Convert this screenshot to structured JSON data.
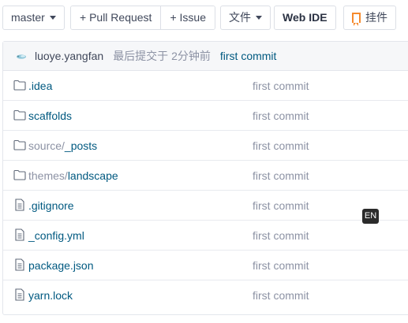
{
  "toolbar": {
    "branch": "master",
    "pull_request": "+ Pull Request",
    "issue": "+ Issue",
    "file_menu": "文件",
    "web_ide": "Web IDE",
    "pendant": "挂件"
  },
  "commit": {
    "author": "luoye.yangfan",
    "last_commit_label": "最后提交于 2分钟前",
    "message": "first commit"
  },
  "files": [
    {
      "type": "folder",
      "prefix": "",
      "name": ".idea",
      "message": "first commit"
    },
    {
      "type": "folder",
      "prefix": "",
      "name": "scaffolds",
      "message": "first commit"
    },
    {
      "type": "folder",
      "prefix": "source/",
      "name": "_posts",
      "message": "first commit"
    },
    {
      "type": "folder",
      "prefix": "themes/",
      "name": "landscape",
      "message": "first commit"
    },
    {
      "type": "file",
      "prefix": "",
      "name": ".gitignore",
      "message": "first commit"
    },
    {
      "type": "file",
      "prefix": "",
      "name": "_config.yml",
      "message": "first commit"
    },
    {
      "type": "file",
      "prefix": "",
      "name": "package.json",
      "message": "first commit"
    },
    {
      "type": "file",
      "prefix": "",
      "name": "yarn.lock",
      "message": "first commit"
    }
  ],
  "ime_badge": "EN",
  "colors": {
    "link": "#005980",
    "muted": "#8c92a4",
    "accent_orange": "#f68a2d"
  }
}
